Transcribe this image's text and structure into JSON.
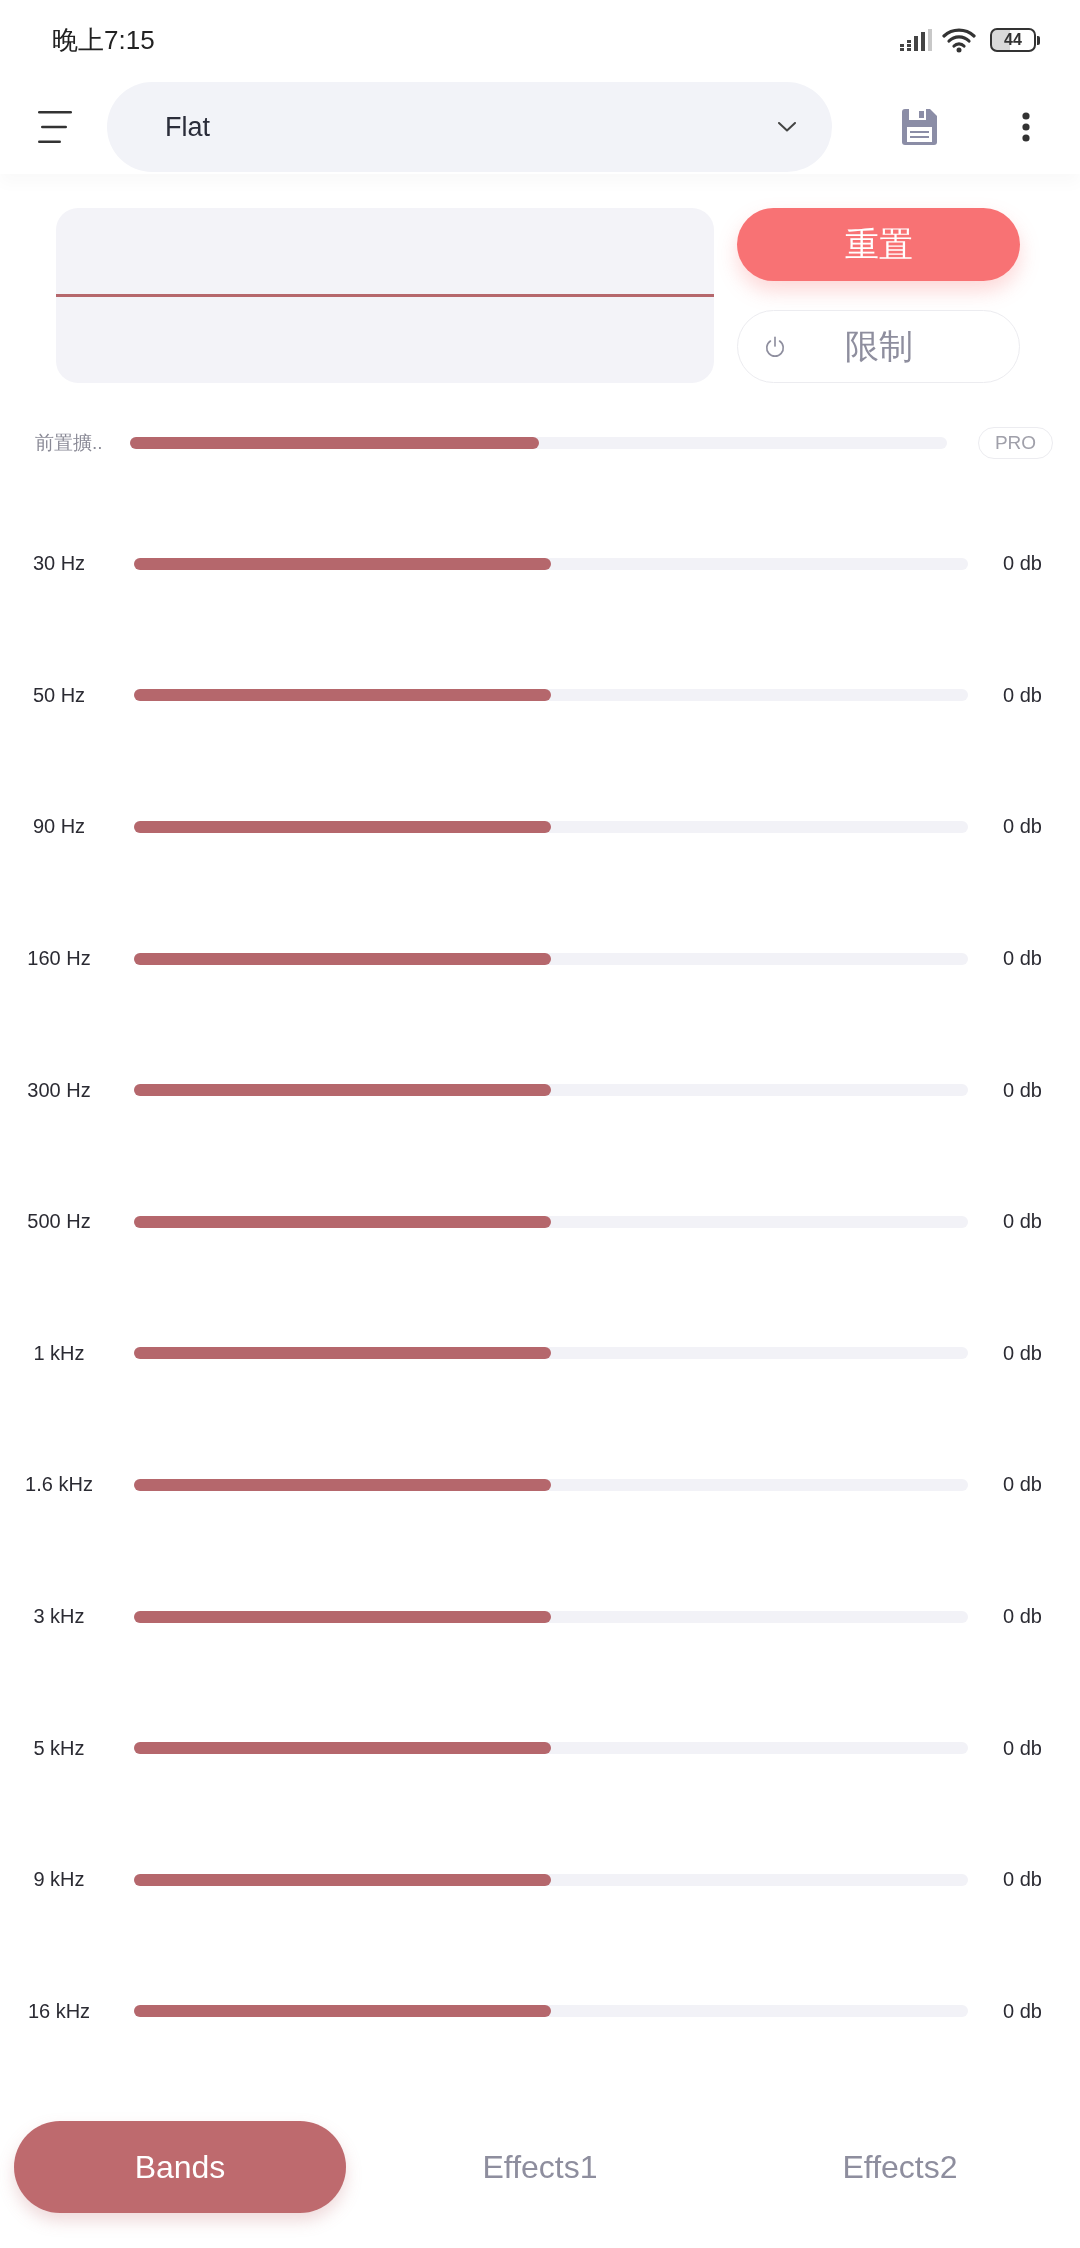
{
  "status_bar": {
    "time": "晚上7:15",
    "battery": "44"
  },
  "toolbar": {
    "preset": "Flat"
  },
  "actions": {
    "reset": "重置",
    "limiter": {
      "label": "限制",
      "on": false
    }
  },
  "preamp": {
    "label": "前置擴..",
    "level": 0.5,
    "badge": "PRO"
  },
  "bands": [
    {
      "label": "30 Hz",
      "level": 0.5,
      "reading": "0 db"
    },
    {
      "label": "50 Hz",
      "level": 0.5,
      "reading": "0 db"
    },
    {
      "label": "90 Hz",
      "level": 0.5,
      "reading": "0 db"
    },
    {
      "label": "160 Hz",
      "level": 0.5,
      "reading": "0 db"
    },
    {
      "label": "300 Hz",
      "level": 0.5,
      "reading": "0 db"
    },
    {
      "label": "500 Hz",
      "level": 0.5,
      "reading": "0 db"
    },
    {
      "label": "1 kHz",
      "level": 0.5,
      "reading": "0 db"
    },
    {
      "label": "1.6 kHz",
      "level": 0.5,
      "reading": "0 db"
    },
    {
      "label": "3 kHz",
      "level": 0.5,
      "reading": "0 db"
    },
    {
      "label": "5 kHz",
      "level": 0.5,
      "reading": "0 db"
    },
    {
      "label": "9 kHz",
      "level": 0.5,
      "reading": "0 db"
    },
    {
      "label": "16 kHz",
      "level": 0.5,
      "reading": "0 db"
    }
  ],
  "tabs": [
    {
      "label": "Bands",
      "selected": true
    },
    {
      "label": "Effects1",
      "selected": false
    },
    {
      "label": "Effects2",
      "selected": false
    }
  ]
}
